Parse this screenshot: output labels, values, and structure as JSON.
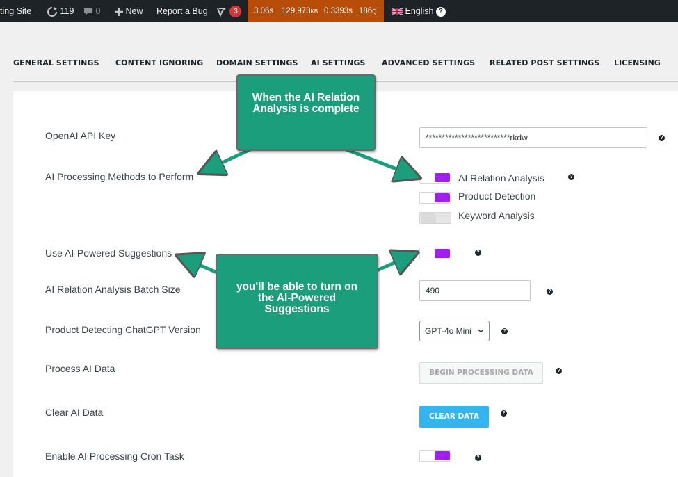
{
  "admin_bar": {
    "site_name": "ting Site",
    "updates_count": "119",
    "comments_count": "0",
    "new_label": "New",
    "report_bug_label": "Report a Bug",
    "seo_badge_count": "3",
    "qm_time": "3.06s",
    "qm_memory": "129,973",
    "qm_memory_unit": "KB",
    "qm_db_time": "0.3393s",
    "qm_queries": "186",
    "qm_queries_unit": "Q",
    "language_label": "English",
    "help_glyph": "?"
  },
  "tabs": [
    {
      "label": "GENERAL SETTINGS"
    },
    {
      "label": "CONTENT IGNORING"
    },
    {
      "label": "DOMAIN SETTINGS"
    },
    {
      "label": "AI SETTINGS"
    },
    {
      "label": "ADVANCED SETTINGS"
    },
    {
      "label": "RELATED POST SETTINGS"
    },
    {
      "label": "LICENSING"
    }
  ],
  "settings": {
    "api_key": {
      "label": "OpenAI API Key",
      "value": "**************************rkdw"
    },
    "methods": {
      "label": "AI Processing Methods to Perform",
      "options": [
        {
          "label": "AI Relation Analysis",
          "enabled": true
        },
        {
          "label": "Product Detection",
          "enabled": true
        },
        {
          "label": "Keyword Analysis",
          "enabled": false
        }
      ]
    },
    "suggestions": {
      "label": "Use AI-Powered Suggestions",
      "enabled": true
    },
    "batch_size": {
      "label": "AI Relation Analysis Batch Size",
      "value": "490"
    },
    "gpt_version": {
      "label": "Product Detecting ChatGPT Version",
      "selected": "GPT-4o Mini"
    },
    "process": {
      "label": "Process AI Data",
      "button": "BEGIN PROCESSING DATA"
    },
    "clear": {
      "label": "Clear AI Data",
      "button": "CLEAR DATA"
    },
    "cron": {
      "label": "Enable AI Processing Cron Task",
      "enabled": true
    }
  },
  "help_glyph": "?",
  "callouts": {
    "top": "When the AI Relation Analysis is complete",
    "middle": "you'll be able to turn on the AI-Powered Suggestions"
  },
  "colors": {
    "toggle_on": "#a020f0",
    "callout": "#1a9e7c",
    "clear_button": "#33b5f0",
    "admin_bar": "#1d2327",
    "query_monitor": "#b84d0a"
  }
}
